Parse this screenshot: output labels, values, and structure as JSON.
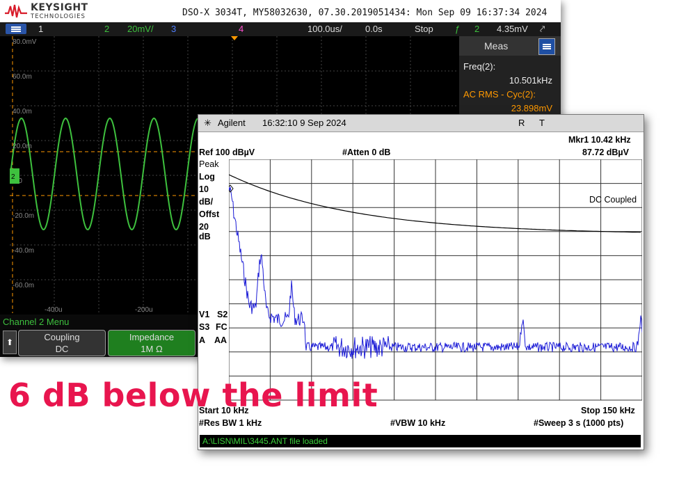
{
  "scope": {
    "brand": "KEYSIGHT",
    "brand_sub": "TECHNOLOGIES",
    "title": "DSO-X 3034T, MY58032630, 07.30.2019051434: Mon Sep 09 16:37:34 2024",
    "status": {
      "ch1": "1",
      "ch2": "2",
      "ch2_scale": "20mV/",
      "ch3": "3",
      "ch4": "4",
      "timebase": "100.0us/",
      "delay": "0.0s",
      "run_state": "Stop",
      "trig_channel": "2",
      "trig_level": "4.35mV"
    },
    "y_labels": [
      "80.0mV",
      "60.0m",
      "40.0m",
      "20.0m",
      "0.0",
      "-20.0m",
      "-40.0m",
      "-60.0m"
    ],
    "x_labels": [
      "-400u",
      "-200u"
    ],
    "meas": {
      "title": "Meas",
      "m1_label": "Freq(2):",
      "m1_value": "10.501kHz",
      "m2_label": "AC RMS - Cyc(2):",
      "m2_value": "23.898mV"
    },
    "channel_menu": {
      "title": "Channel 2 Menu",
      "coupling_label": "Coupling",
      "coupling_value": "DC",
      "impedance_label": "Impedance",
      "impedance_value": "1M Ω"
    },
    "colors": {
      "ch2_trace": "#3ec13e",
      "accent": "#ff9900",
      "meas_value": "#ff9900"
    }
  },
  "analyzer": {
    "brand": "Agilent",
    "timestamp": "16:32:10  9 Sep 2024",
    "r": "R",
    "t": "T",
    "marker": "Mkr1  10.42 kHz",
    "marker_level": "87.72 dBµV",
    "ref": "Ref 100 dBµV",
    "atten": "#Atten 0 dB",
    "left_labels": [
      "Peak",
      "Log",
      "10",
      "dB/",
      "Offst",
      "20",
      "dB"
    ],
    "v1": "V1",
    "s2": "S2",
    "s3": "S3",
    "fc": "FC",
    "a": "A",
    "aa": "AA",
    "dc_coupled": "DC Coupled",
    "start": "Start 10 kHz",
    "stop": "Stop 150 kHz",
    "rbw": "#Res BW 1 kHz",
    "vbw": "#VBW 10 kHz",
    "sweep": "#Sweep 3 s (1000 pts)",
    "file_status": "A:\\LISN\\MIL\\3445.ANT file loaded",
    "colors": {
      "trace": "#1a1ad6",
      "limit": "#000000",
      "status_text": "#3cd23c"
    }
  },
  "caption": "6 dB below the limit"
}
